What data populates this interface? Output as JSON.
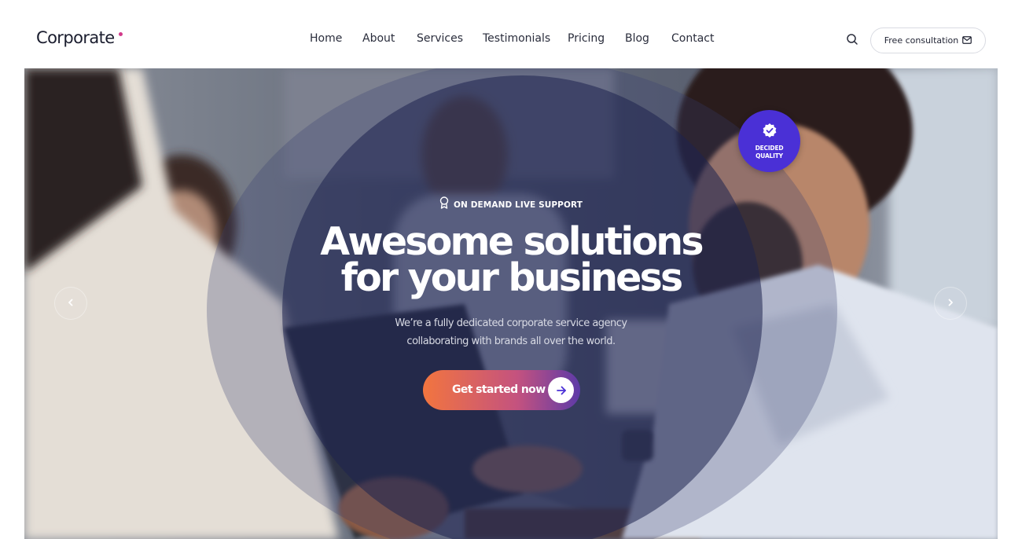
{
  "header": {
    "logo": "Corporate",
    "nav": [
      "Home",
      "About",
      "Services",
      "Testimonials",
      "Pricing",
      "Blog",
      "Contact"
    ],
    "search_icon": "search-icon",
    "cta_label": "Free consultation",
    "cta_icon": "mail-icon"
  },
  "hero": {
    "badge_icon": "verified-check-icon",
    "badge_line1": "DECIDED",
    "badge_line2": "QUALITY",
    "eyebrow_icon": "award-icon",
    "eyebrow": "ON DEMAND LIVE SUPPORT",
    "headline_line1": "Awesome solutions",
    "headline_line2": "for your business",
    "sub_line1": "We’re a fully dedicated corporate service agency",
    "sub_line2": "collaborating with brands all over the world.",
    "button_label": "Get started now",
    "button_icon": "arrow-right-icon",
    "prev_icon": "chevron-left-icon",
    "next_icon": "chevron-right-icon"
  },
  "colors": {
    "accent": "#4a30d6",
    "button_gradient_start": "#f2753f",
    "button_gradient_end": "#5d3aa8",
    "logo_dot": "#d23a8a",
    "overlay": "#1e224e"
  }
}
